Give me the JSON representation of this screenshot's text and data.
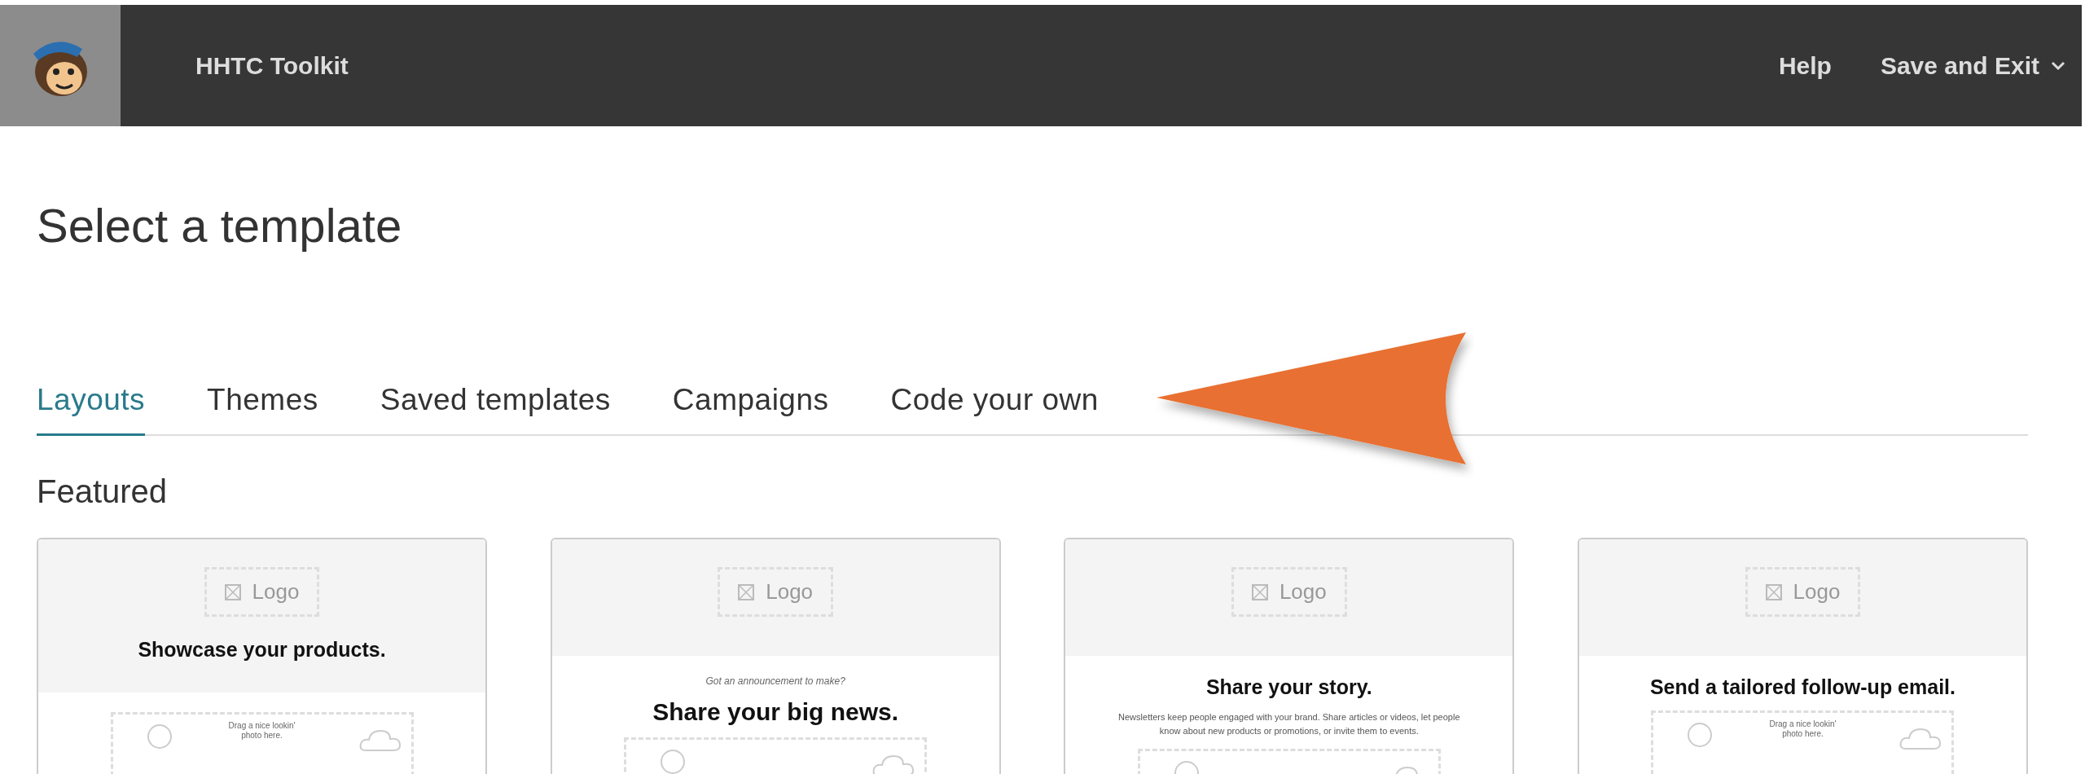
{
  "top_bar": {
    "title": "HHTC Toolkit",
    "links": [
      {
        "label": "Help",
        "has_menu": false
      },
      {
        "label": "Save and Exit",
        "has_menu": true
      }
    ]
  },
  "page_title": "Select a template",
  "tabs": [
    {
      "label": "Layouts",
      "selected": true
    },
    {
      "label": "Themes",
      "selected": false
    },
    {
      "label": "Saved templates",
      "selected": false
    },
    {
      "label": "Campaigns",
      "selected": false
    },
    {
      "label": "Code your own",
      "selected": false
    }
  ],
  "section_title": "Featured",
  "cards": [
    {
      "logo": "Logo",
      "headline_in_header": true,
      "headline": "Showcase your products.",
      "photo_caption": "Drag a nice lookin' photo here."
    },
    {
      "logo": "Logo",
      "headline_in_header": false,
      "kicker": "Got an announcement to make?",
      "headline": "Share your big news."
    },
    {
      "logo": "Logo",
      "headline_in_header": false,
      "headline": "Share your story.",
      "body": "Newsletters keep people engaged with your brand. Share articles or videos, let people know about new products or promotions, or invite them to events."
    },
    {
      "logo": "Logo",
      "headline_in_header": false,
      "headline": "Send a tailored follow-up email.",
      "photo_caption": "Drag a nice lookin' photo here."
    }
  ]
}
